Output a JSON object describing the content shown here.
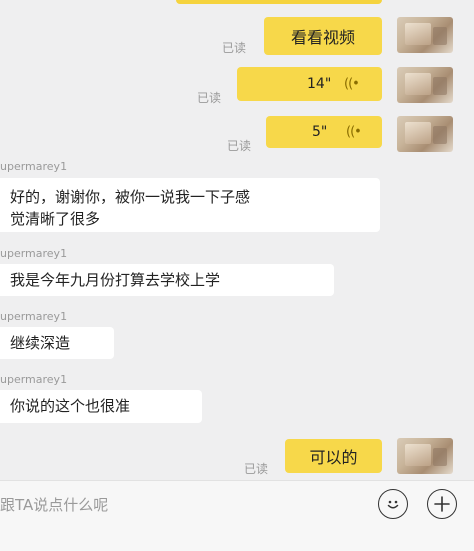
{
  "messages": {
    "m1": {
      "text": "看看视频",
      "read": "已读"
    },
    "m2": {
      "duration": "14\"",
      "read": "已读"
    },
    "m3": {
      "duration": "5\"",
      "read": "已读"
    },
    "m4": {
      "user": "upermarey1",
      "text_line1": "好的，谢谢你，被你一说我一下子感",
      "text_line2": "觉清晰了很多"
    },
    "m5": {
      "user": "upermarey1",
      "text": "我是今年九月份打算去学校上学"
    },
    "m6": {
      "user": "upermarey1",
      "text": "继续深造"
    },
    "m7": {
      "user": "upermarey1",
      "text": "你说的这个也很准"
    },
    "m8": {
      "text": "可以的",
      "read": "已读"
    }
  },
  "input": {
    "placeholder": "跟TA说点什么呢"
  },
  "icons": {
    "voice": "voice-wave-icon",
    "emoji": "smiley-icon",
    "add": "plus-icon"
  },
  "colors": {
    "my_bubble": "#f7d84a",
    "other_bubble": "#ffffff",
    "background": "#efeff0",
    "read_text": "#9a9a9a"
  }
}
